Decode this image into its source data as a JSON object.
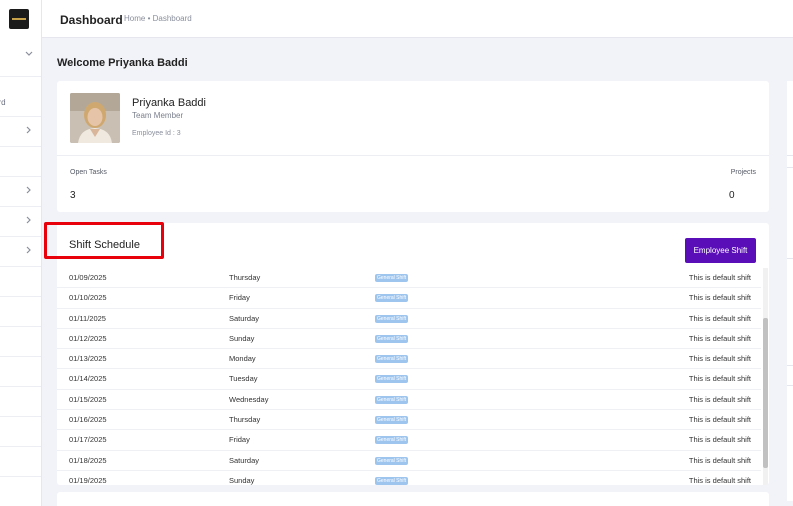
{
  "header": {
    "title": "Dashboard",
    "breadcrumb": "Home • Dashboard"
  },
  "sidebar": {
    "partial_label": "ard",
    "chevron_icon": "chevron-right-icon"
  },
  "welcome": "Welcome Priyanka Baddi",
  "profile": {
    "name": "Priyanka Baddi",
    "role": "Team Member",
    "employee_id": "Employee Id : 3",
    "open_tasks_label": "Open Tasks",
    "open_tasks_value": "3",
    "projects_label": "Projects",
    "projects_value": "0"
  },
  "shift": {
    "title": "Shift Schedule",
    "button_label": "Employee Shift",
    "rows": [
      {
        "date": "01/09/2025",
        "day": "Thursday",
        "shift": "General Shift",
        "desc": "This is default shift"
      },
      {
        "date": "01/10/2025",
        "day": "Friday",
        "shift": "General Shift",
        "desc": "This is default shift"
      },
      {
        "date": "01/11/2025",
        "day": "Saturday",
        "shift": "General Shift",
        "desc": "This is default shift"
      },
      {
        "date": "01/12/2025",
        "day": "Sunday",
        "shift": "General Shift",
        "desc": "This is default shift"
      },
      {
        "date": "01/13/2025",
        "day": "Monday",
        "shift": "General Shift",
        "desc": "This is default shift"
      },
      {
        "date": "01/14/2025",
        "day": "Tuesday",
        "shift": "General Shift",
        "desc": "This is default shift"
      },
      {
        "date": "01/15/2025",
        "day": "Wednesday",
        "shift": "General Shift",
        "desc": "This is default shift"
      },
      {
        "date": "01/16/2025",
        "day": "Thursday",
        "shift": "General Shift",
        "desc": "This is default shift"
      },
      {
        "date": "01/17/2025",
        "day": "Friday",
        "shift": "General Shift",
        "desc": "This is default shift"
      },
      {
        "date": "01/18/2025",
        "day": "Saturday",
        "shift": "General Shift",
        "desc": "This is default shift"
      },
      {
        "date": "01/19/2025",
        "day": "Sunday",
        "shift": "General Shift",
        "desc": "This is default shift"
      }
    ]
  },
  "colors": {
    "accent_button": "#5a0eb8",
    "badge": "#9ec5ee",
    "highlight": "#e8000b"
  }
}
